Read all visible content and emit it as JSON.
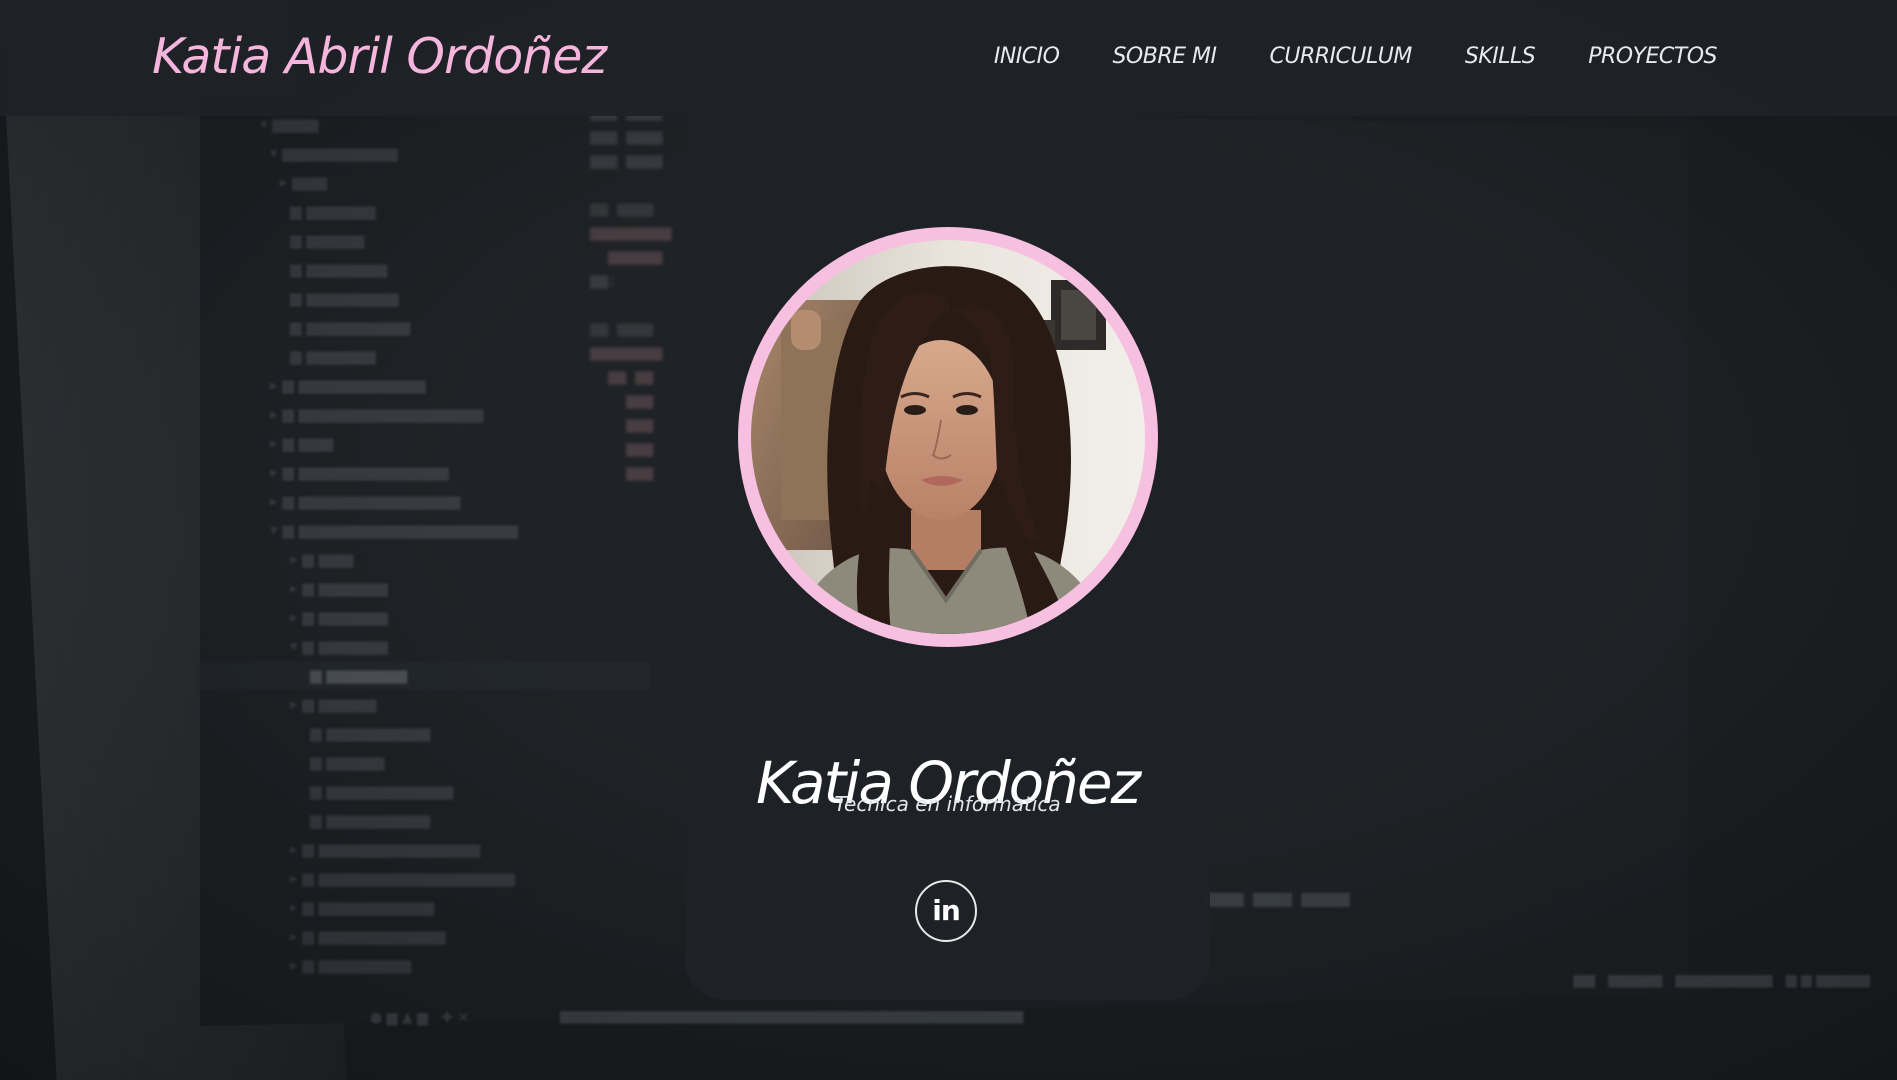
{
  "brand": "Katia Abril Ordoñez",
  "nav": [
    {
      "label": "INICIO"
    },
    {
      "label": "SOBRE MI"
    },
    {
      "label": "CURRICULUM"
    },
    {
      "label": "SKILLS"
    },
    {
      "label": "PROYECTOS"
    }
  ],
  "profile": {
    "name": "Katia Ordoñez",
    "subtitle": "Tecnica en informatica",
    "social_icon": "linkedin-icon",
    "social_label": "in"
  },
  "colors": {
    "accent": "#f5b5dc",
    "ring": "#f7bfe0",
    "header_bg": "#1e2125",
    "card_bg": "#1f2226",
    "text": "#e7e9ec"
  }
}
